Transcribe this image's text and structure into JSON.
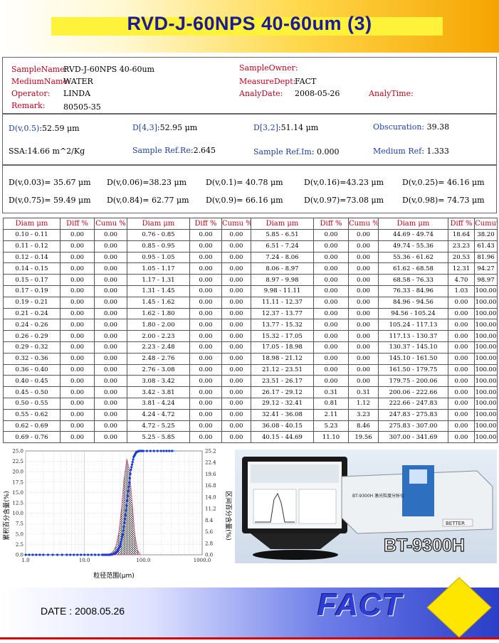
{
  "title": "RVD-J-60NPS 40-60um (3)",
  "info": {
    "sample_name_label": "SampleName:",
    "sample_name": "RVD-J-60NPS 40-60um",
    "medium_name_label": "MediumName:",
    "medium_name": "WATER",
    "operator_label": "Operator:",
    "operator": "LINDA",
    "remark_label": "Remark:",
    "remark": "80505-35",
    "sample_owner_label": "SampleOwner:",
    "measure_dept_label": "MeasureDept:",
    "measure_dept": "FACT",
    "analy_date_label": "AnalyDate:",
    "analy_date": "2008-05-26",
    "analy_time_label": "AnalyTime:"
  },
  "stats": {
    "dv05_label": "D(v,0.5)",
    "dv05": ":52.59 μm",
    "d43_label": "D[4,3]",
    "d43": ":52.95 μm",
    "d32_label": "D[3,2]",
    "d32": ":51.14 μm",
    "obscuration_label": "Obscuration:",
    "obscuration": "39.38",
    "ssa": "SSA:14.66 m^2/Kg",
    "sample_ref_re_label": "Sample Ref.Re",
    "sample_ref_re": ":2.645",
    "sample_ref_im_label": "Sample Ref.Im",
    "sample_ref_im": ": 0.000",
    "medium_ref_label": "Medium Ref",
    "medium_ref": ": 1.333"
  },
  "percentiles": [
    "D(v,0.03)= 35.67 μm",
    "D(v,0.06)=38.23 μm",
    "D(v,0.1)= 40.78 μm",
    "D(v,0.16)=43.23 μm",
    "D(v,0.25)= 46.16 μm",
    "D(v,0.75)= 59.49 μm",
    "D(v,0.84)= 62.77 μm",
    "D(v,0.9)= 66.16 μm",
    "D(v,0.97)=73.08 μm",
    "D(v,0.98)= 74.73 μm"
  ],
  "table": {
    "headers": [
      "Diam μm",
      "Diff %",
      "Cumu %",
      "Diam μm",
      "Diff %",
      "Cumu %",
      "Diam μm",
      "Diff %",
      "Cumu %",
      "Diam μm",
      "Diff %",
      "Cumu%"
    ],
    "rows": [
      [
        "0.10 - 0.11",
        "0.00",
        "0.00",
        "0.76 - 0.85",
        "0.00",
        "0.00",
        "5.85 - 6.51",
        "0.00",
        "0.00",
        "44.69 - 49.74",
        "18.64",
        "38.20"
      ],
      [
        "0.11 - 0.12",
        "0.00",
        "0.00",
        "0.85 - 0.95",
        "0.00",
        "0.00",
        "6.51 - 7.24",
        "0.00",
        "0.00",
        "49.74 - 55.36",
        "23.23",
        "61.43"
      ],
      [
        "0.12 - 0.14",
        "0.00",
        "0.00",
        "0.95 - 1.05",
        "0.00",
        "0.00",
        "7.24 - 8.06",
        "0.00",
        "0.00",
        "55.36 - 61.62",
        "20.53",
        "81.96"
      ],
      [
        "0.14 - 0.15",
        "0.00",
        "0.00",
        "1.05 - 1.17",
        "0.00",
        "0.00",
        "8.06 - 8.97",
        "0.00",
        "0.00",
        "61.62 - 68.58",
        "12.31",
        "94.27"
      ],
      [
        "0.15 - 0.17",
        "0.00",
        "0.00",
        "1.17 - 1.31",
        "0.00",
        "0.00",
        "8.97 - 9.98",
        "0.00",
        "0.00",
        "68.58 - 76.33",
        "4.70",
        "98.97"
      ],
      [
        "0.17 - 0.19",
        "0.00",
        "0.00",
        "1.31 - 1.45",
        "0.00",
        "0.00",
        "9.98 - 11.11",
        "0.00",
        "0.00",
        "76.33 - 84.96",
        "1.03",
        "100.00"
      ],
      [
        "0.19 - 0.21",
        "0.00",
        "0.00",
        "1.45 - 1.62",
        "0.00",
        "0.00",
        "11.11 - 12.37",
        "0.00",
        "0.00",
        "84.96 - 94.56",
        "0.00",
        "100.00"
      ],
      [
        "0.21 - 0.24",
        "0.00",
        "0.00",
        "1.62 - 1.80",
        "0.00",
        "0.00",
        "12.37 - 13.77",
        "0.00",
        "0.00",
        "94.56 - 105.24",
        "0.00",
        "100.00"
      ],
      [
        "0.24 - 0.26",
        "0.00",
        "0.00",
        "1.80 - 2.00",
        "0.00",
        "0.00",
        "13.77 - 15.32",
        "0.00",
        "0.00",
        "105.24 - 117.13",
        "0.00",
        "100.00"
      ],
      [
        "0.26 - 0.29",
        "0.00",
        "0.00",
        "2.00 - 2.23",
        "0.00",
        "0.00",
        "15.32 - 17.05",
        "0.00",
        "0.00",
        "117.13 - 130.37",
        "0.00",
        "100.00"
      ],
      [
        "0.29 - 0.32",
        "0.00",
        "0.00",
        "2.23 - 2.48",
        "0.00",
        "0.00",
        "17.05 - 18.98",
        "0.00",
        "0.00",
        "130.37 - 145.10",
        "0.00",
        "100.00"
      ],
      [
        "0.32 - 0.36",
        "0.00",
        "0.00",
        "2.48 - 2.76",
        "0.00",
        "0.00",
        "18.98 - 21.12",
        "0.00",
        "0.00",
        "145.10 - 161.50",
        "0.00",
        "100.00"
      ],
      [
        "0.36 - 0.40",
        "0.00",
        "0.00",
        "2.76 - 3.08",
        "0.00",
        "0.00",
        "21.12 - 23.51",
        "0.00",
        "0.00",
        "161.50 - 179.75",
        "0.00",
        "100.00"
      ],
      [
        "0.40 - 0.45",
        "0.00",
        "0.00",
        "3.08 - 3.42",
        "0.00",
        "0.00",
        "23.51 - 26.17",
        "0.00",
        "0.00",
        "179.75 - 200.06",
        "0.00",
        "100.00"
      ],
      [
        "0.45 - 0.50",
        "0.00",
        "0.00",
        "3.42 - 3.81",
        "0.00",
        "0.00",
        "26.17 - 29.12",
        "0.31",
        "0.31",
        "200.06 - 222.66",
        "0.00",
        "100.00"
      ],
      [
        "0.50 - 0.55",
        "0.00",
        "0.00",
        "3.81 - 4.24",
        "0.00",
        "0.00",
        "29.12 - 32.41",
        "0.81",
        "1.12",
        "222.66 - 247.83",
        "0.00",
        "100.00"
      ],
      [
        "0.55 - 0.62",
        "0.00",
        "0.00",
        "4.24 - 4.72",
        "0.00",
        "0.00",
        "32.41 - 36.08",
        "2.11",
        "3.23",
        "247.83 - 275.83",
        "0.00",
        "100.00"
      ],
      [
        "0.62 - 0.69",
        "0.00",
        "0.00",
        "4.72 - 5.25",
        "0.00",
        "0.00",
        "36.08 - 40.15",
        "5.23",
        "8.46",
        "275.83 - 307.00",
        "0.00",
        "100.00"
      ],
      [
        "0.69 - 0.76",
        "0.00",
        "0.00",
        "5.25 - 5.85",
        "0.00",
        "0.00",
        "40.15 - 44.69",
        "11.10",
        "19.56",
        "307.00 - 341.69",
        "0.00",
        "100.00"
      ]
    ]
  },
  "chart_data": {
    "type": "area",
    "x_scale": "log",
    "xlim": [
      1.0,
      1000.0
    ],
    "x_ticks": [
      "1.0",
      "10.0",
      "100.0",
      "1000.0"
    ],
    "y_left_ticks": [
      "0.0",
      "2.5",
      "5.0",
      "7.5",
      "10.0",
      "12.5",
      "15.0",
      "17.5",
      "20.0",
      "22.5",
      "25.0"
    ],
    "y_right_ticks": [
      "0.0",
      "2.8",
      "5.6",
      "8.4",
      "11.2",
      "14.0",
      "16.8",
      "19.6",
      "22.4",
      "25.2"
    ],
    "ylabel_left": "累积百分含量(%)",
    "ylabel_right": "区间百分含量(%)",
    "xlabel": "粒径范围(μm)",
    "grid": true,
    "diff_series": {
      "x": [
        27.6,
        30.7,
        34.2,
        38.1,
        42.4,
        47.1,
        52.5,
        58.4,
        65.0,
        72.3,
        80.5,
        89.6
      ],
      "values": [
        0.31,
        0.81,
        2.11,
        5.23,
        11.1,
        18.64,
        23.23,
        20.53,
        12.31,
        4.7,
        1.03,
        0.0
      ]
    },
    "cumu_series": {
      "x": [
        1.0,
        2.0,
        5.0,
        10.0,
        20.0,
        26.17,
        29.12,
        32.41,
        36.08,
        40.15,
        44.69,
        49.74,
        55.36,
        61.62,
        68.58,
        76.33,
        84.96,
        100.0,
        200.0,
        341.69
      ],
      "values": [
        0,
        0,
        0,
        0,
        0,
        0,
        0.31,
        1.12,
        3.23,
        8.46,
        19.56,
        38.2,
        61.43,
        81.96,
        94.27,
        98.97,
        100.0,
        100.0,
        100.0,
        100.0
      ]
    },
    "colors": {
      "cumu": "#1a3bd8",
      "diff": "#e0508a",
      "grid": "#c8c8c8"
    }
  },
  "photo": {
    "model_label": "BT-9300H",
    "panel_text": "BT-9300H 激光粒度分析仪",
    "brand": "BETTER"
  },
  "footer": {
    "date": "DATE : 2008.05.26",
    "brand": "FACT"
  }
}
